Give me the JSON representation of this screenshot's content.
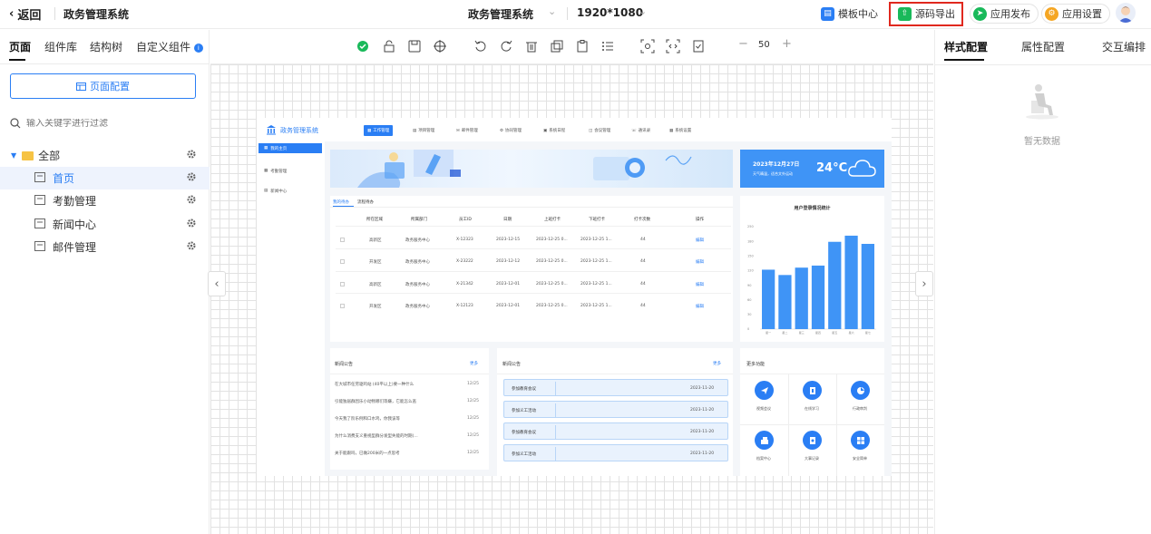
{
  "topbar": {
    "back_label": "返回",
    "app_title": "政务管理系统",
    "center_title": "政务管理系统",
    "resolution": "1920*1080",
    "template_center": "模板中心",
    "source_export": "源码导出",
    "app_publish": "应用发布",
    "app_settings": "应用设置"
  },
  "left": {
    "tabs": [
      "页面",
      "组件库",
      "结构树",
      "自定义组件"
    ],
    "page_config_button": "页面配置",
    "search_placeholder": "输入关键字进行过滤",
    "tree_root": "全部",
    "tree_items": [
      "首页",
      "考勤管理",
      "新闻中心",
      "邮件管理"
    ]
  },
  "toolbar": {
    "zoom": "50"
  },
  "right": {
    "tabs": [
      "样式配置",
      "属性配置",
      "交互编排"
    ],
    "empty_text": "暂无数据"
  },
  "preview": {
    "title": "政务管理系统",
    "nav": [
      "工作管理",
      "项目管理",
      "邮件管理",
      "协同管理",
      "系统日程",
      "会议管理",
      "通讯录",
      "系统设置"
    ],
    "side": [
      "我的主页",
      "考勤管理",
      "新闻中心"
    ],
    "weather": {
      "date": "2023年12月27日",
      "desc": "天气晴温，适合文外运动",
      "temp": "24°C"
    },
    "table": {
      "tabs": [
        "我的待办",
        "流程待办"
      ],
      "headers": [
        "所在区域",
        "所属部门",
        "员工ID",
        "日期",
        "上班打卡",
        "下班打卡",
        "打卡次数",
        "操作"
      ],
      "rows": [
        [
          "高新区",
          "政务服务中心",
          "X-12323",
          "2023-12-15",
          "2023-12-25 0...",
          "2023-12-25 1...",
          "44",
          "编辑"
        ],
        [
          "开发区",
          "政务服务中心",
          "X-23222",
          "2023-12-12",
          "2023-12-25 0...",
          "2023-12-25 1...",
          "44",
          "编辑"
        ],
        [
          "高新区",
          "政务服务中心",
          "X-21342",
          "2023-12-01",
          "2023-12-25 0...",
          "2023-12-25 1...",
          "44",
          "编辑"
        ],
        [
          "开发区",
          "政务服务中心",
          "X-12123",
          "2023-12-01",
          "2023-12-25 0...",
          "2023-12-25 1...",
          "44",
          "编辑"
        ]
      ]
    },
    "chart": {
      "title": "用户登录情况统计",
      "yticks": [
        "250",
        "180",
        "150",
        "120",
        "90",
        "60",
        "30",
        "0"
      ]
    },
    "news": {
      "title": "新闻公告",
      "more": "更多",
      "items": [
        {
          "title": "在大城市任劳驱鸣站 (40平以上)要一种什么",
          "date": "12/25"
        },
        {
          "title": "引能独居群因乐小动物哪们等嫌，它能怎么逃",
          "date": "12/25"
        },
        {
          "title": "今天我了阶乐例和口水鸡，你我该等",
          "date": "12/25"
        },
        {
          "title": "为什么消费支义重视型群分发型失能的时期(…",
          "date": "12/25"
        },
        {
          "title": "关于能跟吗，已做200米的一点思考",
          "date": "12/25"
        }
      ]
    },
    "meetings": {
      "title": "新闻公告",
      "more": "更多",
      "items": [
        {
          "name": "参加教育会议",
          "date": "2023-11-20"
        },
        {
          "name": "参加义工活动",
          "date": "2023-11-20"
        },
        {
          "name": "参加教育会议",
          "date": "2023-11-20"
        },
        {
          "name": "参加义工活动",
          "date": "2023-11-20"
        }
      ]
    },
    "functions": {
      "title": "更多功能",
      "items": [
        "视频会议",
        "在线学习",
        "行政审判",
        "档案中心",
        "大事记录",
        "安全简单"
      ]
    }
  },
  "chart_data": {
    "type": "bar",
    "title": "用户登录情况统计",
    "categories": [
      "星一",
      "星二",
      "星三",
      "星四",
      "星五",
      "星六",
      "星七"
    ],
    "values": [
      145,
      132,
      150,
      155,
      213,
      228,
      208
    ],
    "ylim": [
      0,
      250
    ]
  },
  "colors": {
    "accent": "#2a7ef4",
    "highlight_box": "#e0281e",
    "publish": "#19b95a",
    "settings": "#f5a623"
  }
}
